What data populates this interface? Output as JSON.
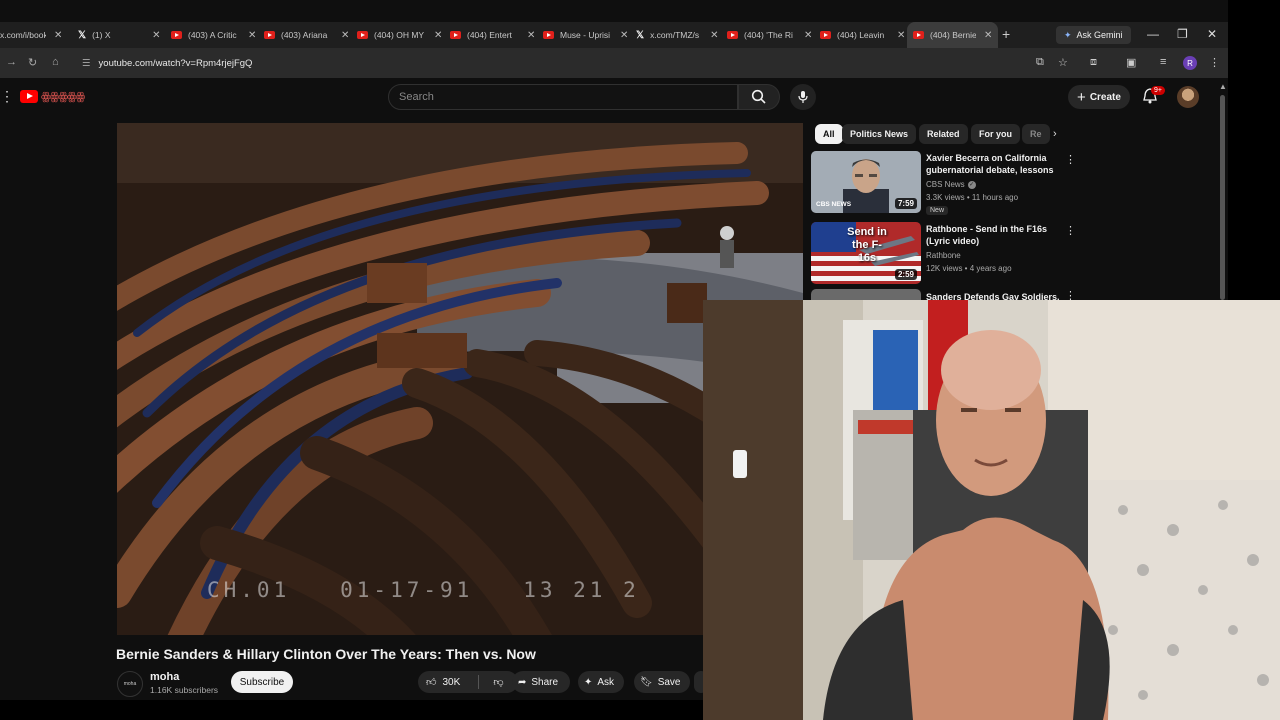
{
  "browser": {
    "tabs": [
      {
        "title": "x.com/i/book",
        "icon": "x-icon"
      },
      {
        "title": "(1) X",
        "icon": "x-icon"
      },
      {
        "title": "(403) A Critic",
        "icon": "youtube-icon"
      },
      {
        "title": "(403) Ariana",
        "icon": "youtube-icon"
      },
      {
        "title": "(404) OH MY",
        "icon": "youtube-icon"
      },
      {
        "title": "(404) Entert",
        "icon": "youtube-icon"
      },
      {
        "title": "Muse - Uprisi",
        "icon": "youtube-icon"
      },
      {
        "title": "x.com/TMZ/s",
        "icon": "x-icon"
      },
      {
        "title": "(404) 'The Ri",
        "icon": "youtube-icon"
      },
      {
        "title": "(404) Leavin",
        "icon": "youtube-icon"
      },
      {
        "title": "(404) Bernie",
        "icon": "youtube-icon",
        "active": true
      }
    ],
    "ask_gemini": "Ask Gemini",
    "url": "youtube.com/watch?v=Rpm4rjejFgQ",
    "profile_initial": "R"
  },
  "youtube": {
    "search_placeholder": "Search",
    "create_label": "Create",
    "notification_count": "9+",
    "chips": [
      "All",
      "Politics News",
      "Related",
      "For you",
      "Re"
    ],
    "video": {
      "title": "Bernie Sanders & Hillary Clinton Over The Years: Then vs. Now",
      "overlay_timestamp": "CH.01   01-17-91   13 21 2",
      "channel": "moha",
      "channel_avatar_text": "moha",
      "subscribers": "1.16K subscribers",
      "subscribe_label": "Subscribe",
      "likes": "30K",
      "share_label": "Share",
      "ask_label": "Ask",
      "save_label": "Save"
    },
    "recommendations": [
      {
        "title": "Xavier Becerra on California gubernatorial debate, lessons ...",
        "channel": "CBS News",
        "verified": true,
        "meta": "3.3K views • 11 hours ago",
        "badge": "New",
        "duration": "7:59",
        "thumb_label": "CBS NEWS"
      },
      {
        "title": "Rathbone - Send in the F16s (Lyric video)",
        "channel": "Rathbone",
        "meta": "12K views • 4 years ago",
        "duration": "2:59",
        "thumb_label": "Send in the F-16s"
      },
      {
        "title": "Sanders Defends Gay Soldiers,",
        "channel": "",
        "meta": ""
      }
    ]
  }
}
